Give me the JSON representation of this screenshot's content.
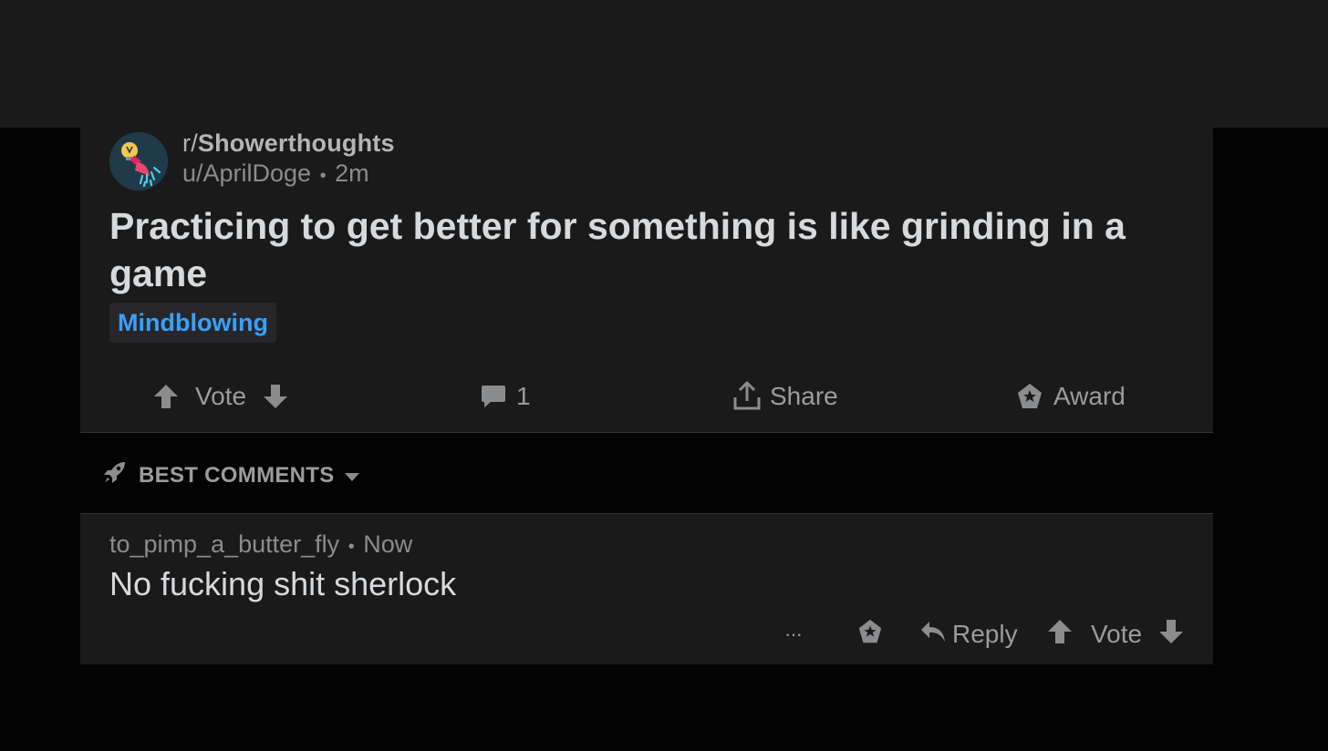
{
  "post": {
    "subreddit_prefix": "r/",
    "subreddit_name": "Showerthoughts",
    "author": "u/AprilDoge",
    "separator": "•",
    "age": "2m",
    "title": "Practicing to get better for something is like grinding in a game",
    "flair": "Mindblowing",
    "avatar_icon": "lightbulb-shower-icon"
  },
  "actions": {
    "vote_label": "Vote",
    "comment_count": "1",
    "share_label": "Share",
    "award_label": "Award"
  },
  "sort": {
    "label": "BEST COMMENTS"
  },
  "comment": {
    "author": "to_pimp_a_butter_fly",
    "separator": "•",
    "age": "Now",
    "body": "No fucking shit sherlock",
    "more_label": "···",
    "reply_label": "Reply",
    "vote_label": "Vote"
  },
  "colors": {
    "background": "#030303",
    "card": "#1a1a1b",
    "flair_text": "#3aa0ff",
    "text_primary": "#d7dadc",
    "text_muted": "#8a8c8e"
  }
}
